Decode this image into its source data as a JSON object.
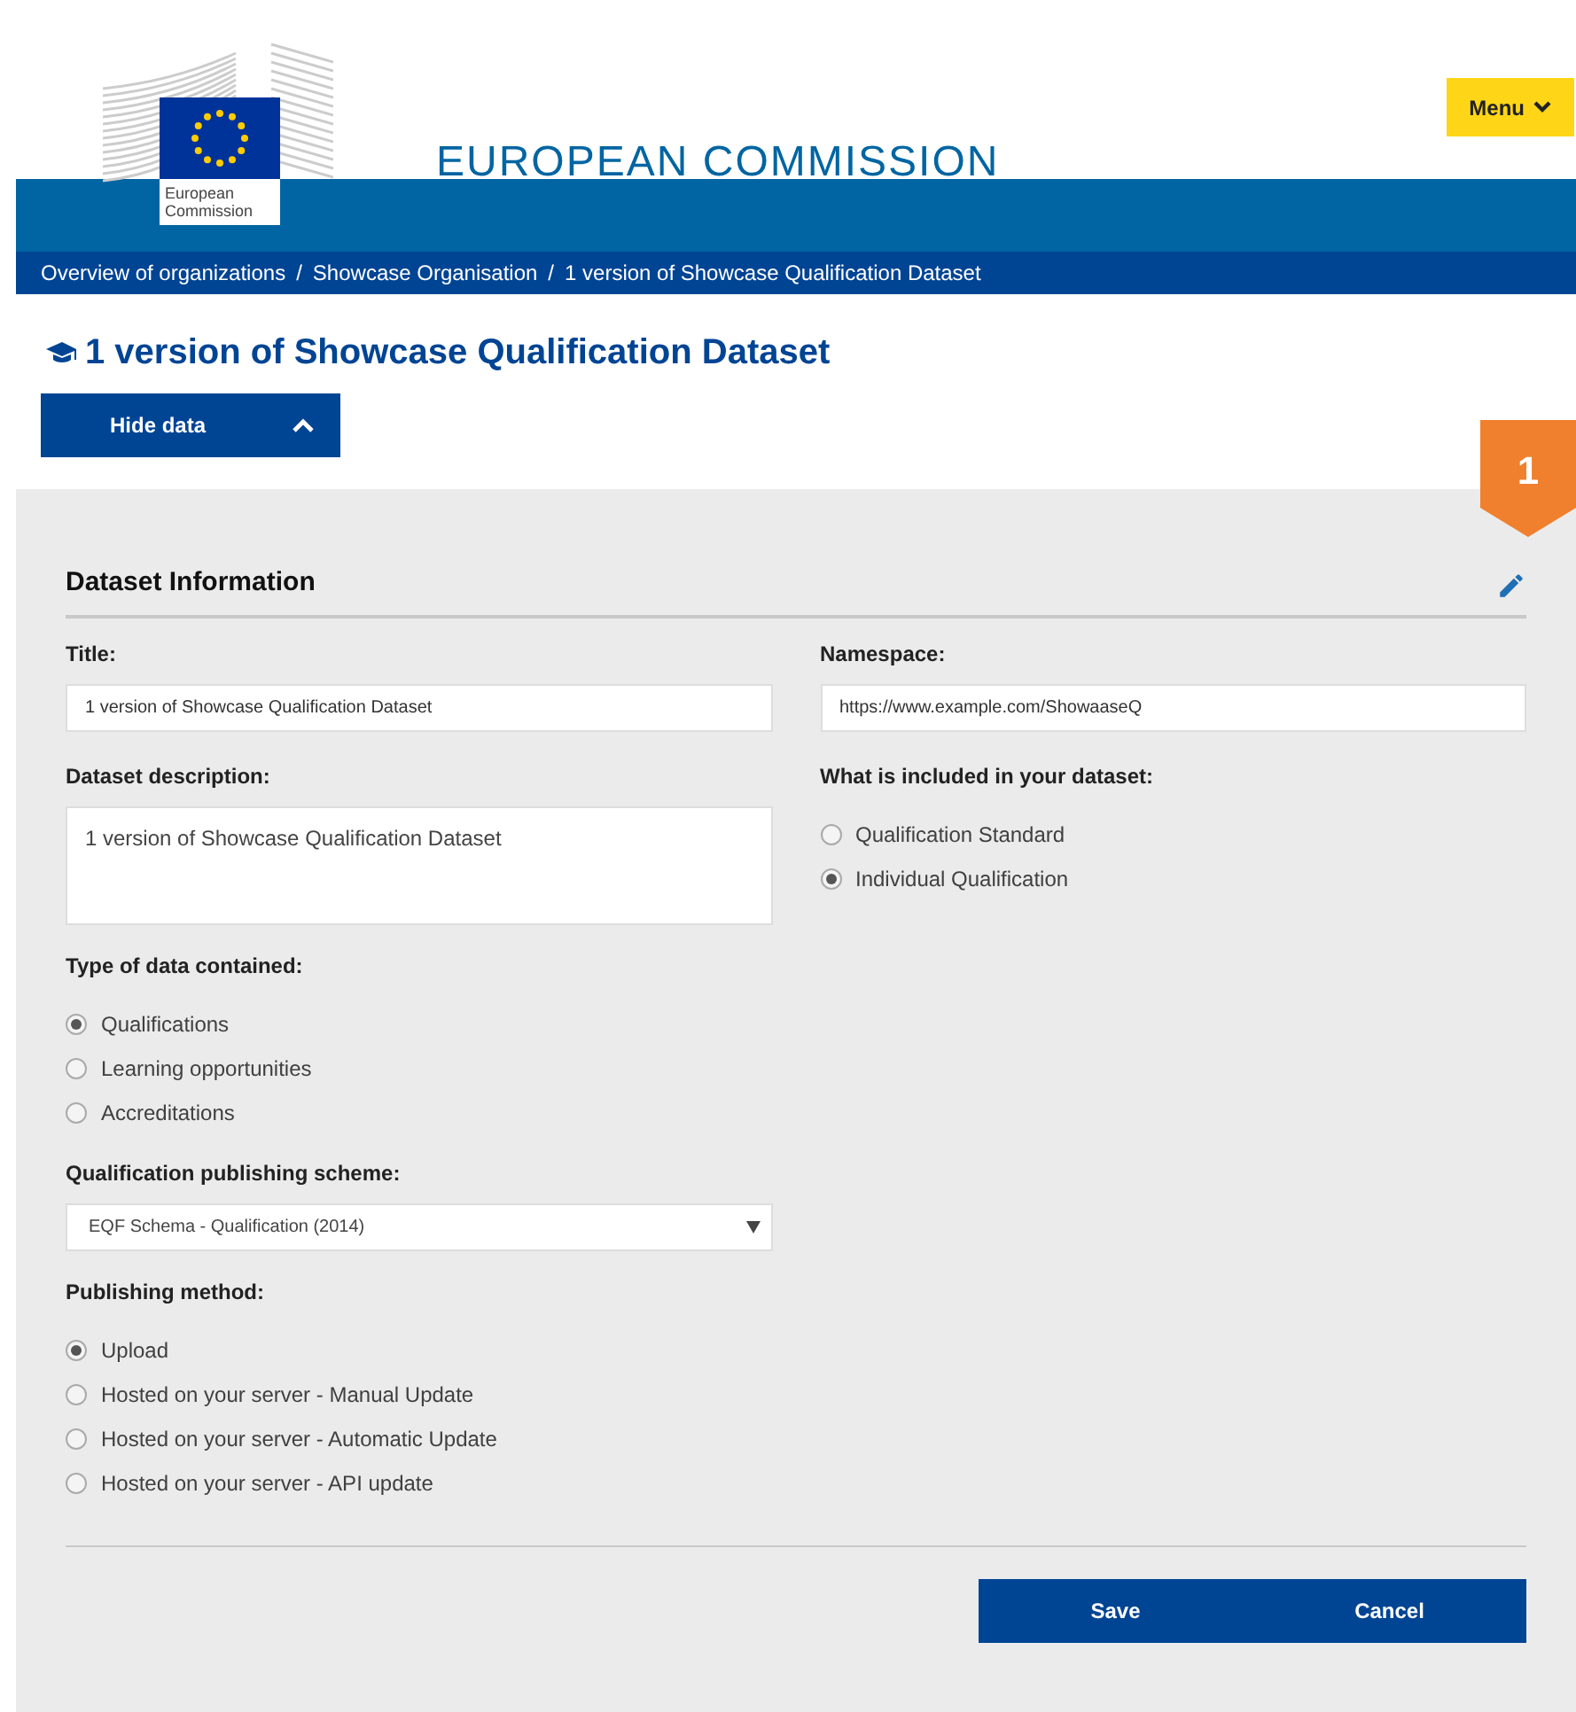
{
  "header": {
    "logo_text": "European Commission",
    "site_title": "EUROPEAN COMMISSION",
    "menu_button": "Menu"
  },
  "breadcrumbs": [
    {
      "label": "Overview of organizations"
    },
    {
      "label": "Showcase Organisation"
    },
    {
      "label": "1 version of Showcase Qualification Dataset"
    }
  ],
  "breadcrumb_separator": "/",
  "page_title": "1 version of Showcase Qualification Dataset",
  "toggle_button": {
    "label": "Hide data",
    "expanded": true
  },
  "step_badge": "1",
  "section": {
    "title": "Dataset Information",
    "left": [
      {
        "kind": "text",
        "label": "Title:",
        "value": "1 version of Showcase Qualification Dataset"
      },
      {
        "kind": "textarea",
        "label": "Dataset description:",
        "value": "1 version of Showcase Qualification Dataset"
      },
      {
        "kind": "radio",
        "label": "Type of data contained:",
        "options": [
          {
            "label": "Qualifications",
            "selected": true
          },
          {
            "label": "Learning opportunities",
            "selected": false
          },
          {
            "label": "Accreditations",
            "selected": false
          }
        ]
      },
      {
        "kind": "select",
        "label": "Qualification publishing scheme:",
        "value": "EQF Schema - Qualification (2014)"
      },
      {
        "kind": "radio",
        "label": "Publishing method:",
        "options": [
          {
            "label": "Upload",
            "selected": true
          },
          {
            "label": "Hosted on your server - Manual Update",
            "selected": false
          },
          {
            "label": "Hosted on your server - Automatic Update",
            "selected": false
          },
          {
            "label": "Hosted on your server - API update",
            "selected": false
          }
        ]
      }
    ],
    "right": [
      {
        "kind": "text",
        "label": "Namespace:",
        "value": "https://www.example.com/ShowaaseQ"
      },
      {
        "kind": "radio",
        "label": "What is included in your dataset:",
        "options": [
          {
            "label": "Qualification Standard",
            "selected": false
          },
          {
            "label": "Individual Qualification",
            "selected": true
          }
        ]
      }
    ]
  },
  "buttons": [
    {
      "label": "Save"
    },
    {
      "label": "Cancel"
    }
  ]
}
